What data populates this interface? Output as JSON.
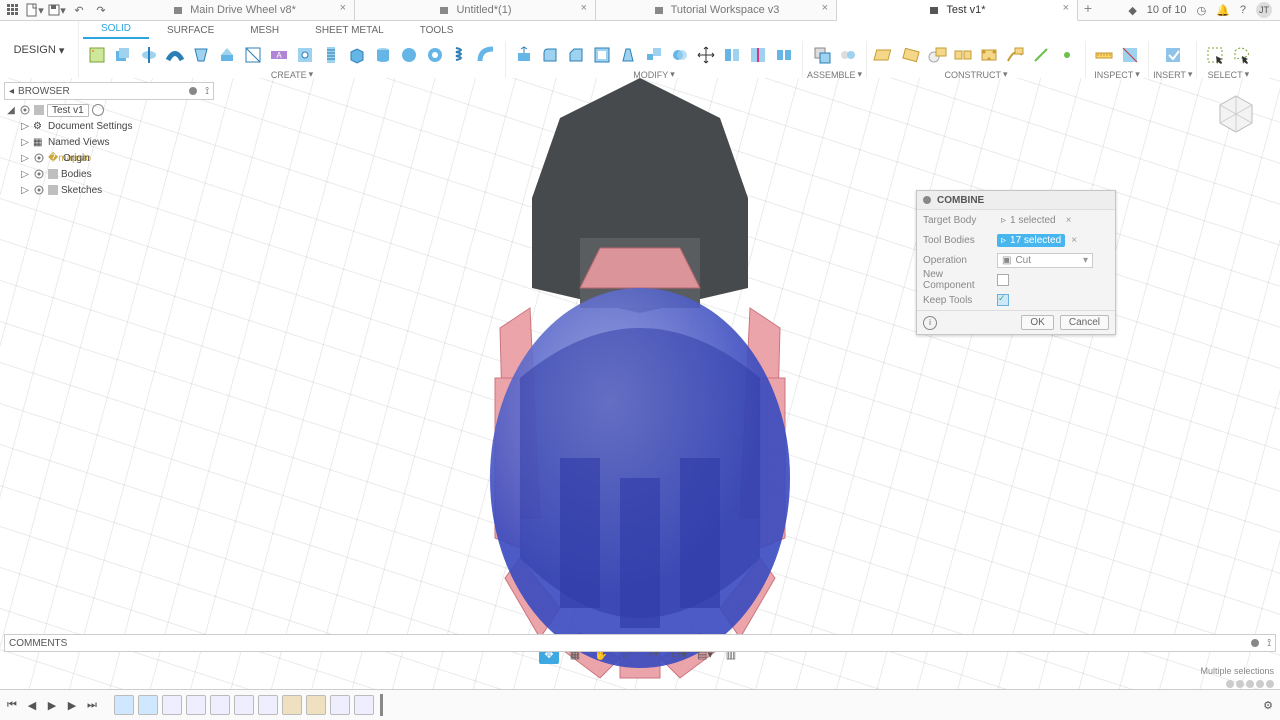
{
  "app": {
    "job_status": "10 of 10",
    "avatar": "JT"
  },
  "tabs": [
    {
      "label": "Main Drive Wheel v8*",
      "active": false
    },
    {
      "label": "Untitled*(1)",
      "active": false
    },
    {
      "label": "Tutorial Workspace v3",
      "active": false
    },
    {
      "label": "Test v1*",
      "active": true
    }
  ],
  "workspace": "DESIGN",
  "ribbon_tabs": [
    "SOLID",
    "SURFACE",
    "MESH",
    "SHEET METAL",
    "TOOLS"
  ],
  "ribbon_groups": {
    "create": "CREATE",
    "modify": "MODIFY",
    "assemble": "ASSEMBLE",
    "construct": "CONSTRUCT",
    "inspect": "INSPECT",
    "insert": "INSERT",
    "select": "SELECT"
  },
  "browser": {
    "title": "BROWSER",
    "root": "Test v1",
    "nodes": [
      "Document Settings",
      "Named Views",
      "Origin",
      "Bodies",
      "Sketches"
    ]
  },
  "dialog": {
    "title": "COMBINE",
    "rows": {
      "target": {
        "label": "Target Body",
        "value": "1 selected"
      },
      "tool": {
        "label": "Tool Bodies",
        "value": "17 selected"
      },
      "op": {
        "label": "Operation",
        "value": "Cut"
      },
      "newc": {
        "label": "New Component"
      },
      "keep": {
        "label": "Keep Tools"
      }
    },
    "ok": "OK",
    "cancel": "Cancel"
  },
  "comments": "COMMENTS",
  "status": "Multiple selections"
}
